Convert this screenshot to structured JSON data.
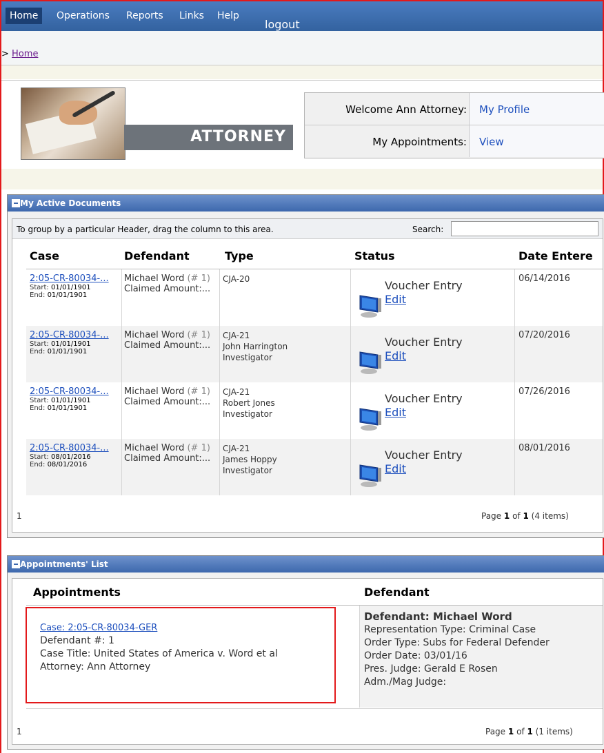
{
  "nav": {
    "items": [
      "Home",
      "Operations",
      "Reports",
      "Links",
      "Help"
    ],
    "logout": "logout"
  },
  "breadcrumb": {
    "prefix": ">",
    "home": "Home"
  },
  "header": {
    "role": "ATTORNEY",
    "welcome_label": "Welcome Ann Attorney:",
    "welcome_link": "My Profile",
    "appointments_label": "My Appointments:",
    "appointments_link": "View"
  },
  "documents": {
    "title": "My Active Documents",
    "group_hint": "To group by a particular Header, drag the column to this area.",
    "search_label": "Search:",
    "search_value": "",
    "columns": [
      "Case",
      "Defendant",
      "Type",
      "Status",
      "Date Entere"
    ],
    "rows": [
      {
        "case": "2:05-CR-80034-...",
        "start": "01/01/1901",
        "end": "01/01/1901",
        "defendant": "Michael Word",
        "defnum": "(# 1)",
        "claimed": "Claimed Amount:...",
        "type1": "CJA-20",
        "type2": "",
        "type3": "",
        "status": "Voucher Entry",
        "edit": "Edit",
        "date": "06/14/2016"
      },
      {
        "case": "2:05-CR-80034-...",
        "start": "01/01/1901",
        "end": "01/01/1901",
        "defendant": "Michael Word",
        "defnum": "(# 1)",
        "claimed": "Claimed Amount:...",
        "type1": "CJA-21",
        "type2": "John Harrington",
        "type3": "Investigator",
        "status": "Voucher Entry",
        "edit": "Edit",
        "date": "07/20/2016"
      },
      {
        "case": "2:05-CR-80034-...",
        "start": "01/01/1901",
        "end": "01/01/1901",
        "defendant": "Michael Word",
        "defnum": "(# 1)",
        "claimed": "Claimed Amount:...",
        "type1": "CJA-21",
        "type2": "Robert Jones",
        "type3": "Investigator",
        "status": "Voucher Entry",
        "edit": "Edit",
        "date": "07/26/2016"
      },
      {
        "case": "2:05-CR-80034-...",
        "start": "08/01/2016",
        "end": "08/01/2016",
        "defendant": "Michael Word",
        "defnum": "(# 1)",
        "claimed": "Claimed Amount:...",
        "type1": "CJA-21",
        "type2": "James Hoppy",
        "type3": "Investigator",
        "status": "Voucher Entry",
        "edit": "Edit",
        "date": "08/01/2016"
      }
    ],
    "start_label": "Start:",
    "end_label": "End:",
    "footer_page": "1",
    "pager": {
      "page_word": "Page",
      "page": "1",
      "of_word": "of",
      "total": "1",
      "items": "(4 items)"
    }
  },
  "appointments": {
    "title": "Appointments' List",
    "columns": [
      "Appointments",
      "Defendant"
    ],
    "case_link": "Case: 2:05-CR-80034-GER",
    "defendant_num": "Defendant #: 1",
    "case_title": "Case Title: United States of America v. Word et al",
    "attorney": "Attorney: Ann Attorney",
    "def_name": "Defendant: Michael Word",
    "rep_type": "Representation Type: Criminal Case",
    "order_type": "Order Type: Subs for Federal Defender",
    "order_date": "Order Date: 03/01/16",
    "pres_judge": "Pres. Judge: Gerald E Rosen",
    "mag_judge": "Adm./Mag Judge:",
    "footer_page": "1",
    "pager": {
      "page_word": "Page",
      "page": "1",
      "of_word": "of",
      "total": "1",
      "items": "(1 items)"
    }
  }
}
